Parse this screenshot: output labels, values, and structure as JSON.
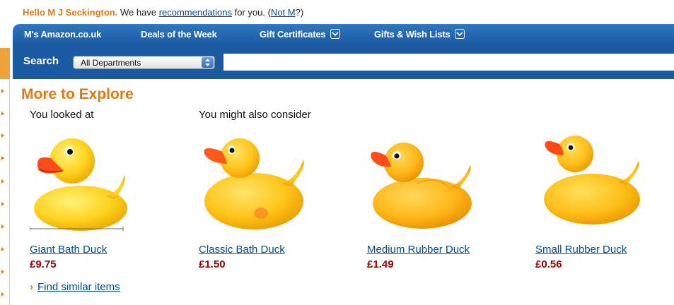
{
  "greeting": {
    "name": "Hello M J Seckington.",
    "prefix": "We have",
    "link": "recommendations",
    "suffix": "for you. (",
    "not_me": "Not M",
    "suffix2": "?)"
  },
  "nav": {
    "items": [
      {
        "label": "M's Amazon.co.uk"
      },
      {
        "label": "Deals of the Week"
      },
      {
        "label": "Gift Certificates"
      },
      {
        "label": "Gifts & Wish Lists"
      }
    ]
  },
  "search": {
    "label": "Search",
    "department": "All Departments",
    "value": ""
  },
  "section": {
    "title": "More to Explore",
    "looked_at": "You looked at",
    "consider": "You might also consider"
  },
  "products": [
    {
      "name": "Giant Bath Duck",
      "price": "£9.75"
    },
    {
      "name": "Classic Bath Duck",
      "price": "£1.50"
    },
    {
      "name": "Medium Rubber Duck",
      "price": "£1.49"
    },
    {
      "name": "Small Rubber Duck",
      "price": "£0.56"
    }
  ],
  "find_similar": "Find similar items",
  "colors": {
    "accent": "#e47911",
    "nav_blue": "#1a5aa3",
    "link": "#004b91",
    "price": "#990000",
    "duck": "#ffcc1a"
  }
}
